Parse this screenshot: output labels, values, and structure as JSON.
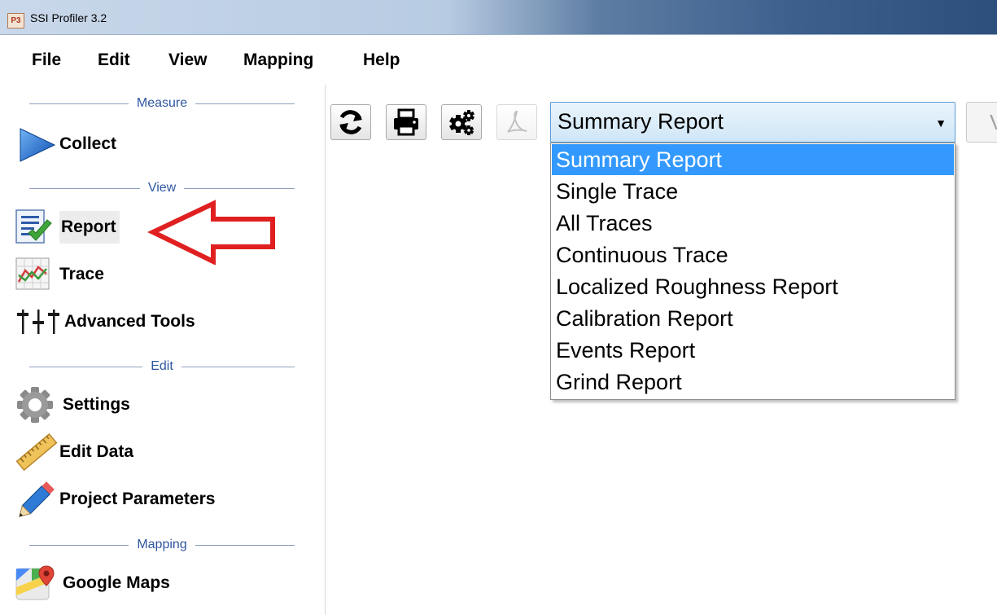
{
  "window": {
    "title": "SSI Profiler 3.2",
    "app_icon": "P3"
  },
  "menu": [
    "File",
    "Edit",
    "View",
    "Mapping",
    "Help"
  ],
  "sidebar": {
    "sections": [
      "Measure",
      "View",
      "Edit",
      "Mapping"
    ],
    "items": [
      {
        "label": "Collect",
        "icon": "play-arrow-icon"
      },
      {
        "label": "Report",
        "icon": "report-check-icon",
        "selected": true
      },
      {
        "label": "Trace",
        "icon": "trace-chart-icon"
      },
      {
        "label": "Advanced Tools",
        "icon": "sliders-icon"
      },
      {
        "label": "Settings",
        "icon": "gear-icon"
      },
      {
        "label": "Edit Data",
        "icon": "ruler-icon"
      },
      {
        "label": "Project Parameters",
        "icon": "pencil-icon"
      },
      {
        "label": "Google Maps",
        "icon": "map-pin-icon"
      }
    ]
  },
  "toolbar": {
    "buttons": [
      "refresh-icon",
      "print-icon",
      "gears-icon",
      "pdf-icon"
    ],
    "report_select": {
      "value": "Summary Report"
    },
    "view_button_label": "V"
  },
  "dropdown": {
    "options": [
      "Summary Report",
      "Single Trace",
      "All Traces",
      "Continuous Trace",
      "Localized Roughness Report",
      "Calibration Report",
      "Events Report",
      "Grind Report"
    ],
    "selected_index": 0
  },
  "colors": {
    "selection": "#3399ff",
    "annotation_arrow": "#e02020",
    "section_text": "#2f56a0"
  }
}
